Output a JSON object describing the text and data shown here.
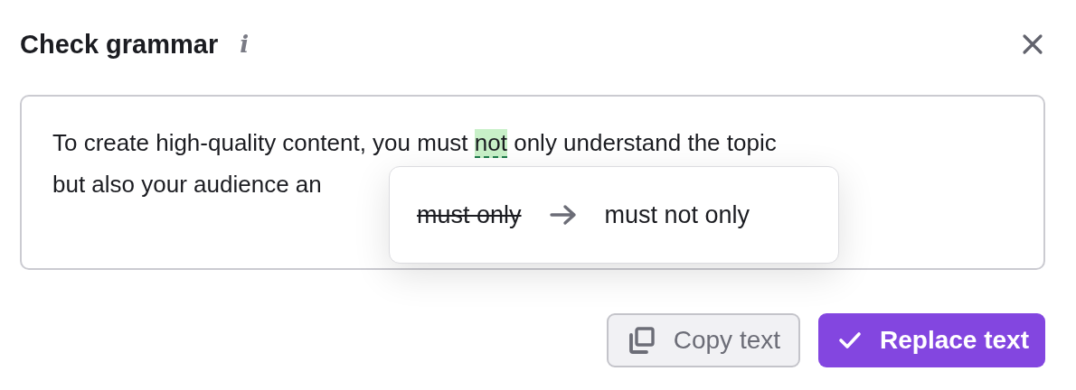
{
  "dialog": {
    "title": "Check grammar",
    "info_icon": "i"
  },
  "editor": {
    "line_1_before": "To create high-quality content, you must ",
    "highlight": "not",
    "line_1_after": " only understand the topic",
    "line_2": "but also your audience an"
  },
  "suggestion": {
    "original": "must only",
    "replacement": "must not only"
  },
  "buttons": [
    {
      "kind": "secondary",
      "label": "Copy text"
    },
    {
      "kind": "primary",
      "label": "Replace text"
    }
  ]
}
